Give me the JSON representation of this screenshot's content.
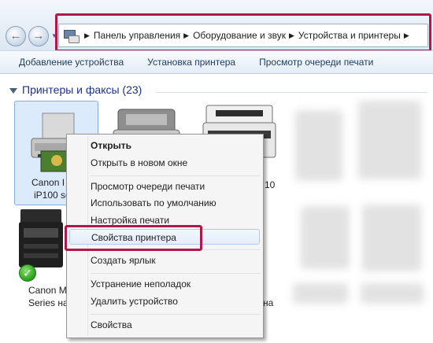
{
  "window": {
    "nav": {
      "back_icon": "back-arrow-icon",
      "forward_icon": "forward-arrow-icon",
      "history_icon": "dropdown-icon"
    },
    "breadcrumb": [
      "Панель управления",
      "Оборудование и звук",
      "Устройства и принтеры"
    ]
  },
  "toolbar": {
    "add_device": "Добавление устройства",
    "install_printer": "Установка принтера",
    "view_queue": "Просмотр очереди печати"
  },
  "content": {
    "group_title": "Принтеры и факсы (23)",
    "devices": [
      {
        "line1": "Canon I",
        "line2": "iP100 se"
      },
      {
        "line1": "",
        "line2": ""
      },
      {
        "line1": "10",
        "line2": ""
      },
      {
        "line1": "Canon M",
        "line2": "Series на"
      },
      {
        "line1": "на",
        "line2": ""
      }
    ]
  },
  "context_menu": {
    "items": [
      {
        "label": "Открыть",
        "bold": true
      },
      {
        "label": "Открыть в новом окне"
      },
      {
        "label": "Просмотр очереди печати"
      },
      {
        "label": "Использовать по умолчанию"
      },
      {
        "label": "Настройка печати"
      },
      {
        "label": "Свойства принтера",
        "highlighted": true
      },
      {
        "label": "Создать ярлык"
      },
      {
        "label": "Устранение неполадок"
      },
      {
        "label": "Удалить устройство"
      },
      {
        "label": "Свойства"
      }
    ]
  },
  "colors": {
    "highlight_box": "#b0184a",
    "group_title": "#1e3287",
    "selection_bg": "#dcebfc"
  }
}
